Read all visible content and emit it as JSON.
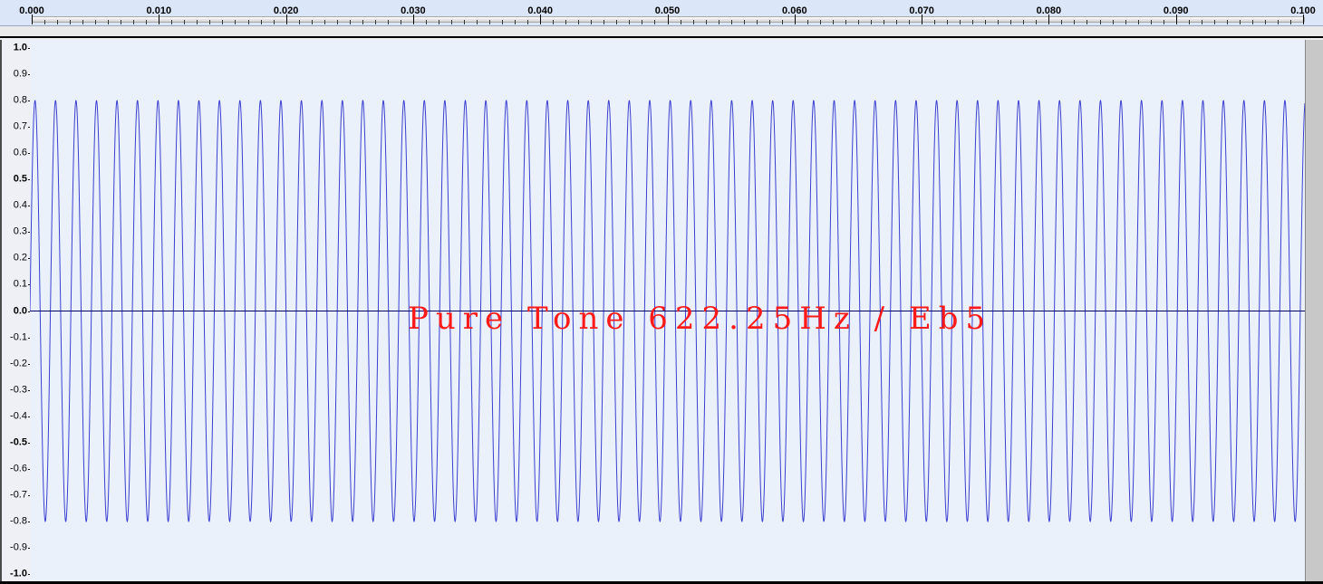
{
  "ruler": {
    "labels": [
      "0.000",
      "0.010",
      "0.020",
      "0.030",
      "0.040",
      "0.050",
      "0.060",
      "0.070",
      "0.080",
      "0.090",
      "0.100"
    ],
    "start": 0.0,
    "end": 0.1
  },
  "amplitude_ruler": {
    "labels": [
      "1.0",
      "0.9",
      "0.8",
      "0.7",
      "0.6",
      "0.5",
      "0.4",
      "0.3",
      "0.2",
      "0.1",
      "0.0",
      "-0.1",
      "-0.2",
      "-0.3",
      "-0.4",
      "-0.5",
      "-0.6",
      "-0.7",
      "-0.8",
      "-0.9",
      "-1.0"
    ],
    "max": 1.0,
    "min": -1.0
  },
  "waveform": {
    "frequency_hz": 622.25,
    "amplitude": 0.8,
    "duration_s": 0.1,
    "color": "#3b3fcf",
    "background": "#eaf1fb",
    "centerline_color": "#000066"
  },
  "overlay": {
    "label": "Pure Tone  622.25Hz / Eb5",
    "color": "#ff1a1a"
  }
}
